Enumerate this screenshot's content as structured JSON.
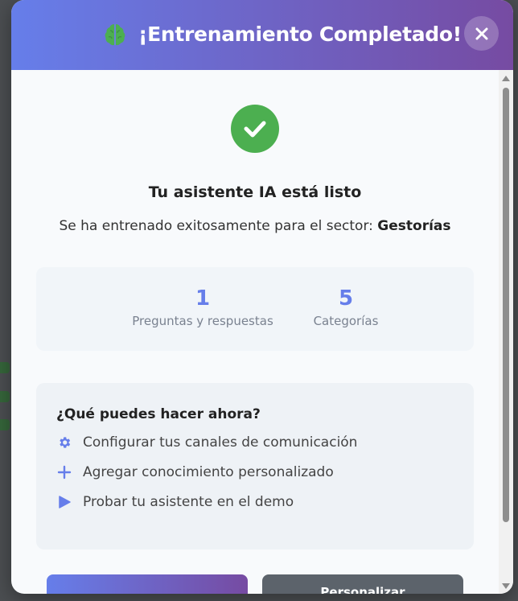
{
  "header": {
    "title": "¡Entrenamiento Completado!",
    "icon": "brain-icon",
    "close_icon": "close-icon"
  },
  "result": {
    "heading": "Tu asistente IA está listo",
    "subtitle_prefix": "Se ha entrenado exitosamente para el sector: ",
    "sector": "Gestorías"
  },
  "stats": [
    {
      "value": "1",
      "label": "Preguntas y respuestas"
    },
    {
      "value": "5",
      "label": "Categorías"
    }
  ],
  "next_steps": {
    "title": "¿Qué puedes hacer ahora?",
    "items": [
      {
        "icon": "gear-icon",
        "label": "Configurar tus canales de comunicación"
      },
      {
        "icon": "plus-icon",
        "label": "Agregar conocimiento personalizado"
      },
      {
        "icon": "play-icon",
        "label": "Probar tu asistente en el demo"
      }
    ]
  },
  "buttons": {
    "primary_label": "",
    "secondary_label": "Personalizar"
  },
  "colors": {
    "gradient_start": "#667eea",
    "gradient_end": "#764ba2",
    "success": "#4caf50",
    "accent": "#667eea"
  }
}
